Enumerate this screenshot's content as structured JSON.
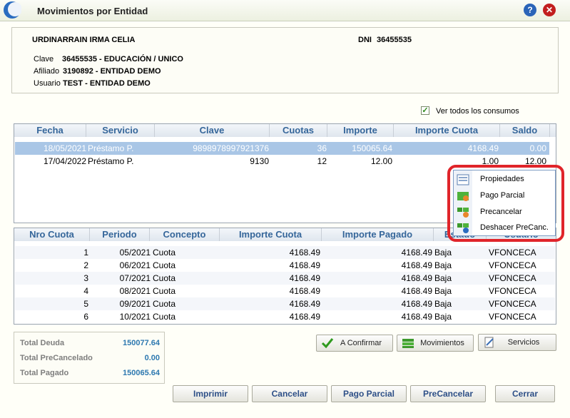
{
  "window": {
    "title": "Movimientos por Entidad"
  },
  "person": {
    "name": "URDINARRAIN IRMA CELIA",
    "dni_label": "DNI",
    "dni": "36455535",
    "clave_label": "Clave",
    "clave_value": "36455535  -  EDUCACIÓN / UNICO",
    "afiliado_label": "Afiliado",
    "afiliado_value": "3190892  -  ENTIDAD DEMO",
    "usuario_label": "Usuario",
    "usuario_value": "TEST  -  ENTIDAD DEMO"
  },
  "ver_todos": {
    "label": "Ver todos los consumos",
    "checked": true
  },
  "loans": {
    "headers": [
      "Fecha",
      "Servicio",
      "Clave",
      "Cuotas",
      "Importe",
      "Importe Cuota",
      "Saldo"
    ],
    "rows": [
      [
        "18/05/2021",
        "Préstamo P.",
        "9898978997921376",
        "36",
        "150065.64",
        "4168.49",
        "0.00"
      ],
      [
        "17/04/2022",
        "Préstamo P.",
        "9130",
        "12",
        "12.00",
        "1.00",
        "12.00"
      ]
    ]
  },
  "installments": {
    "headers": [
      "Nro Cuota",
      "Periodo",
      "Concepto",
      "Importe Cuota",
      "Importe Pagado",
      "Estado",
      "Usuario"
    ],
    "rows": [
      [
        "1",
        "05/2021",
        "Cuota",
        "4168.49",
        "4168.49",
        "Baja",
        "VFONCECA"
      ],
      [
        "2",
        "06/2021",
        "Cuota",
        "4168.49",
        "4168.49",
        "Baja",
        "VFONCECA"
      ],
      [
        "3",
        "07/2021",
        "Cuota",
        "4168.49",
        "4168.49",
        "Baja",
        "VFONCECA"
      ],
      [
        "4",
        "08/2021",
        "Cuota",
        "4168.49",
        "4168.49",
        "Baja",
        "VFONCECA"
      ],
      [
        "5",
        "09/2021",
        "Cuota",
        "4168.49",
        "4168.49",
        "Baja",
        "VFONCECA"
      ],
      [
        "6",
        "10/2021",
        "Cuota",
        "4168.49",
        "4168.49",
        "Baja",
        "VFONCECA"
      ]
    ]
  },
  "totals": {
    "deuda_label": "Total Deuda",
    "deuda": "150077.64",
    "precancel_label": "Total PreCancelado",
    "precancel": "0.00",
    "pagado_label": "Total Pagado",
    "pagado": "150065.64"
  },
  "actions": {
    "confirmar": "A Confirmar",
    "movimientos": "Movimientos",
    "servicios": "Servicios"
  },
  "footer": {
    "imprimir": "Imprimir",
    "cancelar": "Cancelar",
    "pago_parcial": "Pago Parcial",
    "precancelar": "PreCancelar",
    "cerrar": "Cerrar"
  },
  "context_menu": [
    "Propiedades",
    "Pago Parcial",
    "Precancelar",
    "Deshacer PreCanc."
  ],
  "colors": {
    "header_text": "#35669a",
    "selection": "#a9c6e6",
    "highlight": "#e0242a",
    "total_value": "#2d78b0"
  }
}
